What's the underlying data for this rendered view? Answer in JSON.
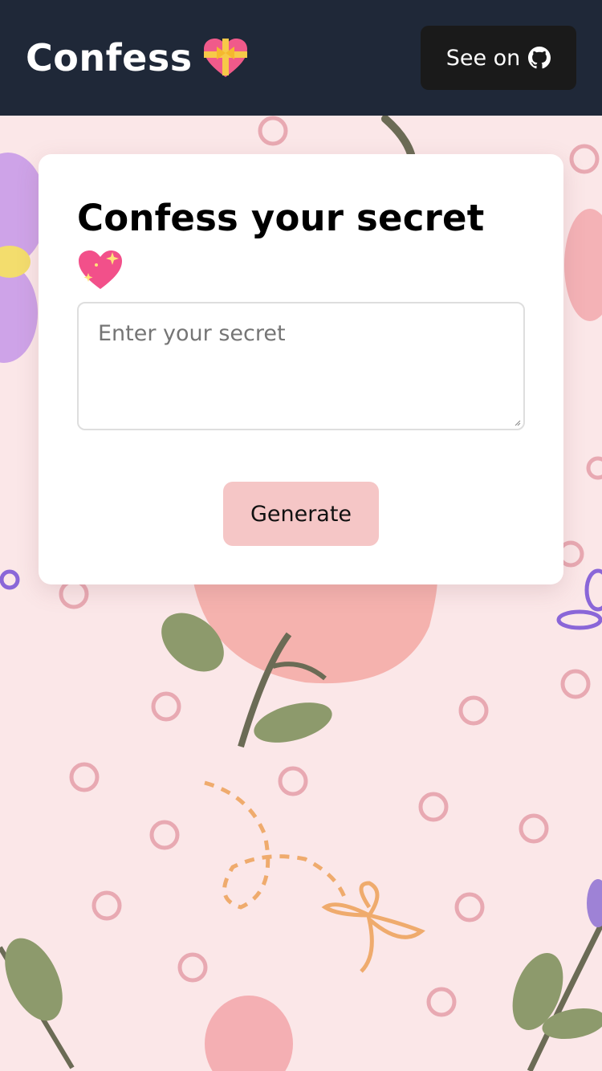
{
  "navbar": {
    "brand": "Confess",
    "brand_icon": "heart-with-ribbon-icon",
    "github_label": "See on",
    "github_icon": "github-icon",
    "bg_color": "#1f2838"
  },
  "card": {
    "title": "Confess your secret",
    "title_icon": "sparkling-heart-icon",
    "input": {
      "placeholder": "Enter your secret",
      "value": ""
    },
    "generate_label": "Generate",
    "accent_color": "#f5c6c6"
  },
  "background": {
    "color": "#fbe7e8",
    "pattern": "floral-pattern"
  }
}
